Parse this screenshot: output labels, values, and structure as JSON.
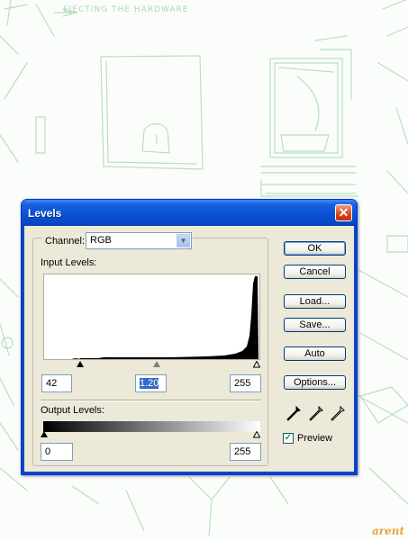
{
  "background": {
    "sketch_text": "EJECTING THE HARDWARE",
    "watermark": "arent"
  },
  "dialog": {
    "title": "Levels",
    "close_label": "✕",
    "channel_label": "Channel:",
    "channel_value": "RGB",
    "input_levels_label": "Input Levels:",
    "input_black": "42",
    "input_gamma": "1.20",
    "input_white": "255",
    "output_levels_label": "Output Levels:",
    "output_black": "0",
    "output_white": "255",
    "buttons": {
      "ok": "OK",
      "cancel": "Cancel",
      "load": "Load...",
      "save": "Save...",
      "auto": "Auto",
      "options": "Options..."
    },
    "eyedroppers": [
      "black-eyedropper-icon",
      "gray-eyedropper-icon",
      "white-eyedropper-icon"
    ],
    "preview_label": "Preview",
    "preview_checked": true,
    "colors": {
      "titlebar": "#0a52d6",
      "dialog_bg": "#ece9d8",
      "close": "#d8421a",
      "selection": "#316ac5"
    }
  }
}
